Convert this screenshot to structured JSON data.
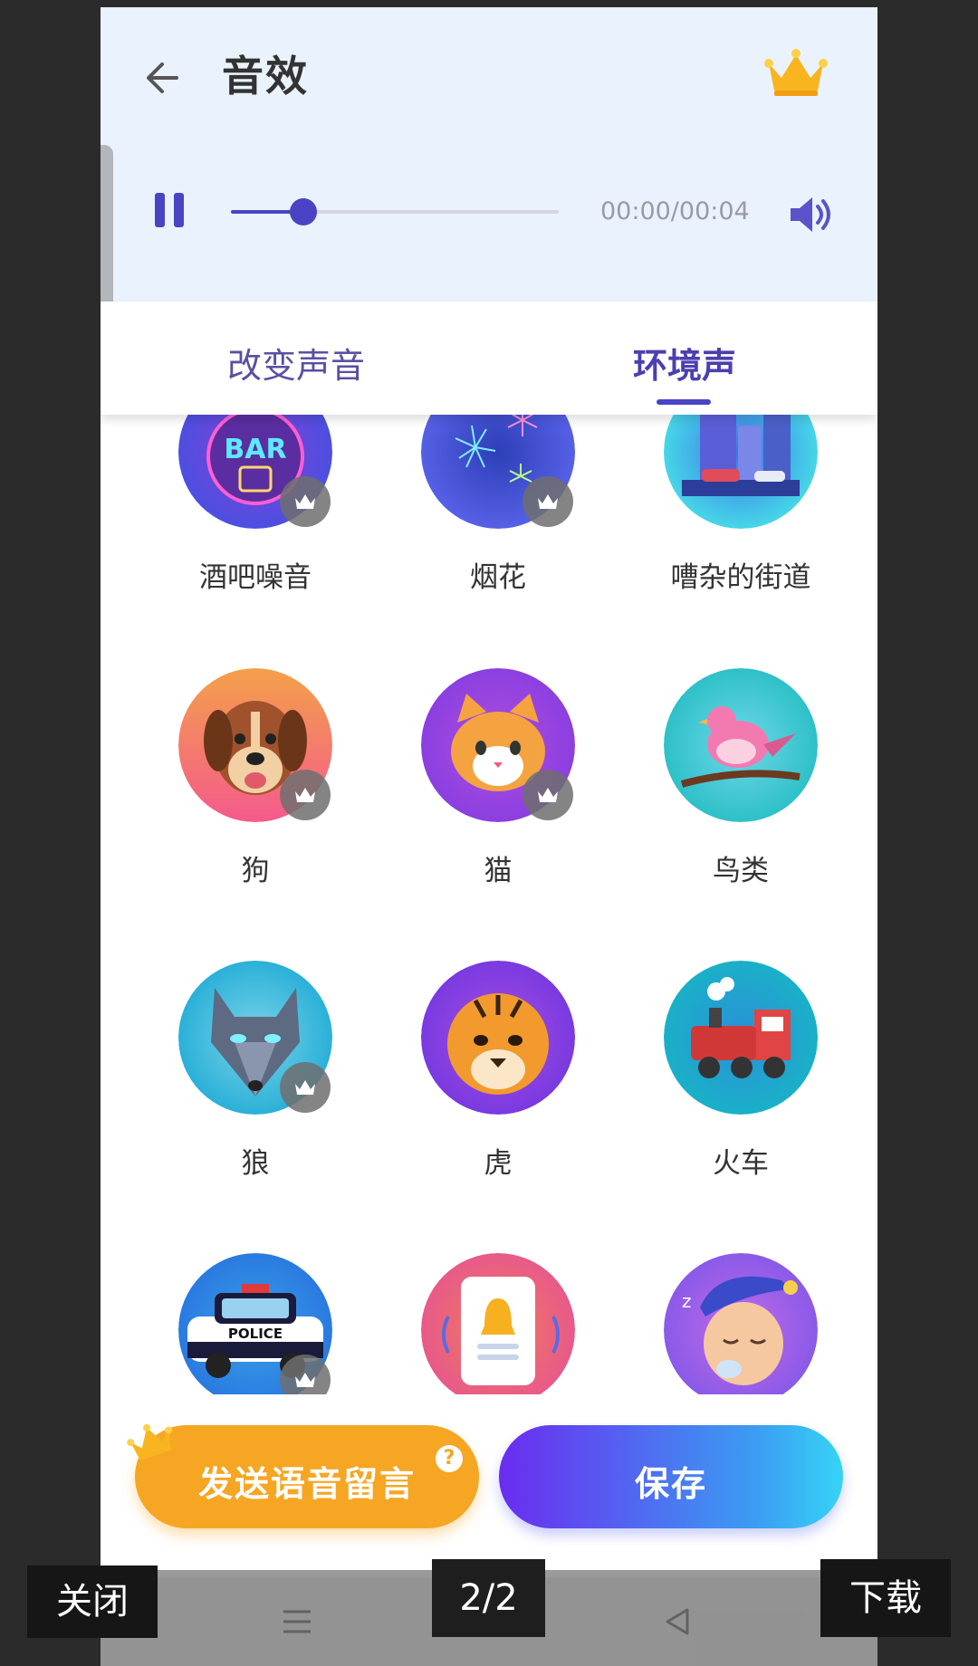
{
  "header": {
    "title": "音效",
    "time_text": "00:00/00:04",
    "progress": 0.22
  },
  "tabs": [
    {
      "label": "改变声音",
      "active": false
    },
    {
      "label": "环境声",
      "active": true
    }
  ],
  "sounds": [
    {
      "label": "酒吧噪音",
      "icon": "bar-sign-icon",
      "premium": true
    },
    {
      "label": "烟花",
      "icon": "fireworks-icon",
      "premium": true
    },
    {
      "label": "嘈杂的街道",
      "icon": "city-street-icon",
      "premium": false
    },
    {
      "label": "狗",
      "icon": "dog-icon",
      "premium": true
    },
    {
      "label": "猫",
      "icon": "cat-icon",
      "premium": true
    },
    {
      "label": "鸟类",
      "icon": "bird-icon",
      "premium": false
    },
    {
      "label": "狼",
      "icon": "wolf-icon",
      "premium": true
    },
    {
      "label": "虎",
      "icon": "tiger-icon",
      "premium": false
    },
    {
      "label": "火车",
      "icon": "train-icon",
      "premium": false
    },
    {
      "label": "",
      "icon": "police-car-icon",
      "premium": true
    },
    {
      "label": "",
      "icon": "doorbell-icon",
      "premium": false
    },
    {
      "label": "",
      "icon": "snoring-icon",
      "premium": false
    }
  ],
  "buttons": {
    "send_voice": "发送语音留言",
    "save": "保存",
    "help": "?"
  },
  "overlay": {
    "close": "关闭",
    "page": "2/2",
    "download": "下载"
  },
  "colors": {
    "accent": "#4a43c4",
    "header_bg": "#eaf3fd",
    "orange": "#f6a623"
  }
}
